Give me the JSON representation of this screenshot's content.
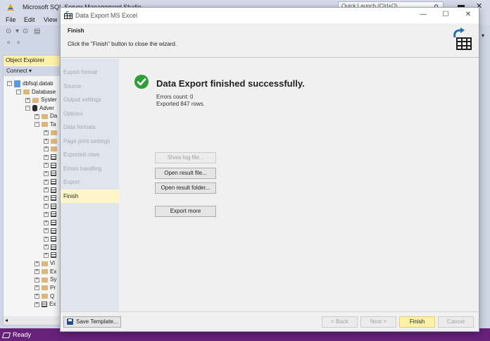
{
  "ssms": {
    "title": "Microsoft SQL Server Management Studio",
    "quick_launch_placeholder": "Quick Launch (Ctrl+Q)",
    "menu": [
      "File",
      "Edit",
      "View"
    ],
    "object_explorer": {
      "title": "Object Explorer",
      "toolbar_label": "Connect ▾",
      "tree": [
        {
          "label": "dbfsql.datab",
          "icon": "server-icon",
          "indent": 0,
          "exp": "−"
        },
        {
          "label": "Database",
          "icon": "folder-icon",
          "indent": 1,
          "exp": "−"
        },
        {
          "label": "Syster",
          "icon": "folder-icon",
          "indent": 2,
          "exp": "+"
        },
        {
          "label": "Adver",
          "icon": "database-icon",
          "indent": 2,
          "exp": "−"
        },
        {
          "label": "Da",
          "icon": "folder-icon",
          "indent": 3,
          "exp": "+"
        },
        {
          "label": "Ta",
          "icon": "folder-icon",
          "indent": 3,
          "exp": "−"
        },
        {
          "label": "",
          "icon": "folder-icon",
          "indent": 4,
          "exp": "+"
        },
        {
          "label": "",
          "icon": "folder-icon",
          "indent": 4,
          "exp": "+"
        },
        {
          "label": "",
          "icon": "folder-icon",
          "indent": 4,
          "exp": "+"
        },
        {
          "label": "",
          "icon": "table-icon",
          "indent": 4,
          "exp": "+"
        },
        {
          "label": "",
          "icon": "table-icon",
          "indent": 4,
          "exp": "+"
        },
        {
          "label": "",
          "icon": "table-icon",
          "indent": 4,
          "exp": "+"
        },
        {
          "label": "",
          "icon": "table-icon",
          "indent": 4,
          "exp": "+"
        },
        {
          "label": "",
          "icon": "table-icon",
          "indent": 4,
          "exp": "+"
        },
        {
          "label": "",
          "icon": "table-icon",
          "indent": 4,
          "exp": "+"
        },
        {
          "label": "",
          "icon": "table-icon",
          "indent": 4,
          "exp": "+"
        },
        {
          "label": "",
          "icon": "table-icon",
          "indent": 4,
          "exp": "+"
        },
        {
          "label": "",
          "icon": "table-icon",
          "indent": 4,
          "exp": "+"
        },
        {
          "label": "",
          "icon": "table-icon",
          "indent": 4,
          "exp": "+"
        },
        {
          "label": "",
          "icon": "table-icon",
          "indent": 4,
          "exp": "+"
        },
        {
          "label": "",
          "icon": "table-icon",
          "indent": 4,
          "exp": "+"
        },
        {
          "label": "",
          "icon": "table-icon",
          "indent": 4,
          "exp": "+"
        },
        {
          "label": "Vi",
          "icon": "folder-icon",
          "indent": 3,
          "exp": "+"
        },
        {
          "label": "Ex",
          "icon": "folder-icon",
          "indent": 3,
          "exp": "+"
        },
        {
          "label": "Sy",
          "icon": "folder-icon",
          "indent": 3,
          "exp": "+"
        },
        {
          "label": "Pr",
          "icon": "folder-icon",
          "indent": 3,
          "exp": "+"
        },
        {
          "label": "Q",
          "icon": "folder-icon",
          "indent": 3,
          "exp": "+"
        },
        {
          "label": "Ex",
          "icon": "table-icon",
          "indent": 3,
          "exp": "+"
        }
      ]
    },
    "status": "Ready",
    "colors": {
      "status_bar": "#68217a",
      "oe_header": "#fff1a8"
    }
  },
  "dialog": {
    "title": "Data Export MS Excel",
    "header_title": "Finish",
    "header_subtitle": "Click the \"Finish\" button to close the wizard.",
    "steps": [
      {
        "label": "Export format",
        "active": false
      },
      {
        "label": "Source",
        "active": false
      },
      {
        "label": "Output settings",
        "active": false
      },
      {
        "label": "Options",
        "active": false
      },
      {
        "label": "Data formats",
        "active": false
      },
      {
        "label": "Page print settings",
        "active": false
      },
      {
        "label": "Exported rows",
        "active": false
      },
      {
        "label": "Errors handling",
        "active": false
      },
      {
        "label": "Export",
        "active": false
      },
      {
        "label": "Finish",
        "active": true
      }
    ],
    "result": {
      "title": "Data Export finished successfully.",
      "errors_count": "Errors count: 0",
      "exported_rows": "Exported 847 rows."
    },
    "actions": {
      "show_log": "Show log file...",
      "open_result_file": "Open result file...",
      "open_result_folder": "Open result folder...",
      "export_more": "Export more"
    },
    "footer": {
      "save_template": "Save Template...",
      "back": "< Back",
      "next": "Next >",
      "finish": "Finish",
      "cancel": "Cancel"
    },
    "colors": {
      "active_step": "#fff7c8",
      "success": "#2e9e3a",
      "primary_button": "#fff2a8"
    }
  }
}
